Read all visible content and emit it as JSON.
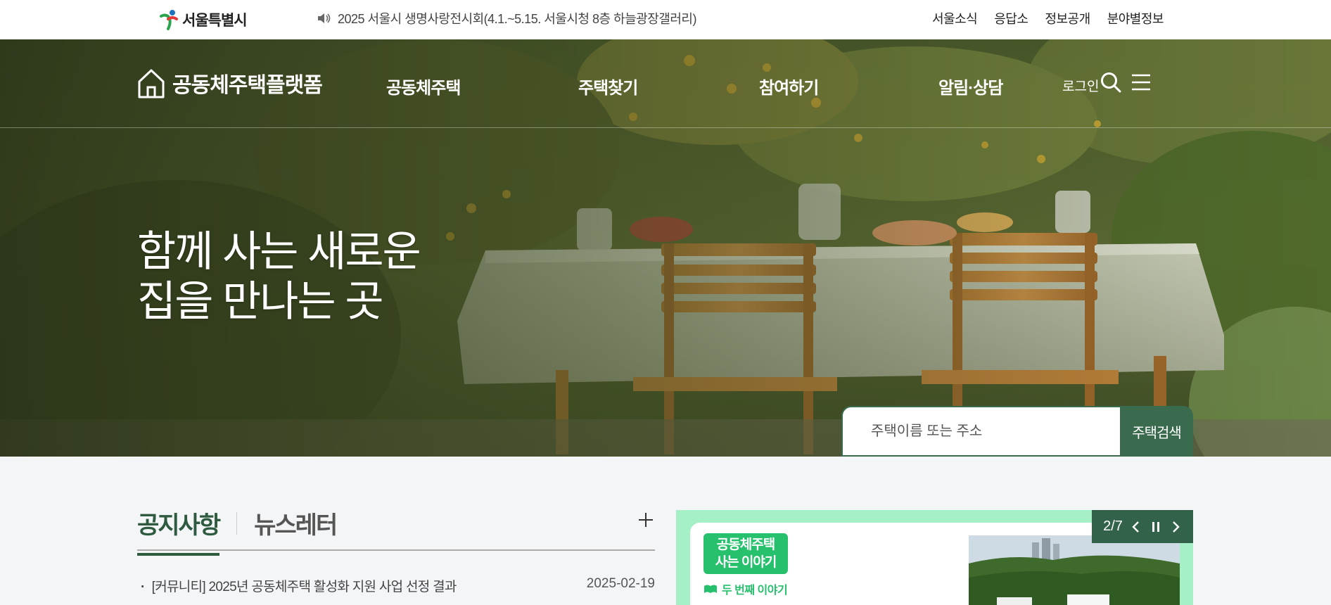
{
  "topbar": {
    "logo_text": "서울특별시",
    "notice_text": "2025 서울시 생명사랑전시회(4.1.~5.15. 서울시청 8층 하늘광장갤러리)",
    "links": [
      "서울소식",
      "응답소",
      "정보공개",
      "분야별정보"
    ]
  },
  "gnb": {
    "brand": "공동체주택플랫폼",
    "menu": [
      "공동체주택",
      "주택찾기",
      "참여하기",
      "알림·상담"
    ],
    "login": "로그인"
  },
  "hero": {
    "title_line1": "함께 사는 새로운",
    "title_line2": "집을 만나는 곳",
    "search_placeholder": "주택이름 또는 주소",
    "search_button": "주택검색"
  },
  "board": {
    "tabs": [
      "공지사항",
      "뉴스레터"
    ],
    "items": [
      {
        "title": "[커뮤니티] 2025년 공동체주택 활성화 지원 사업 선정 결과",
        "date": "2025-02-19"
      }
    ]
  },
  "banner": {
    "tag": "공동체주택 사는 이야기",
    "tag_line1": "공동체주택",
    "tag_line2": "사는 이야기",
    "sub": "두 번째 이야기",
    "counter": "2/7"
  },
  "colors": {
    "brand_green": "#3a6b4f",
    "banner_mint": "#a6f0c8",
    "tag_green": "#27c06d"
  },
  "icons": [
    "speaker-icon",
    "house-icon",
    "search-icon",
    "menu-icon",
    "plus-icon",
    "prev-icon",
    "pause-icon",
    "next-icon"
  ]
}
